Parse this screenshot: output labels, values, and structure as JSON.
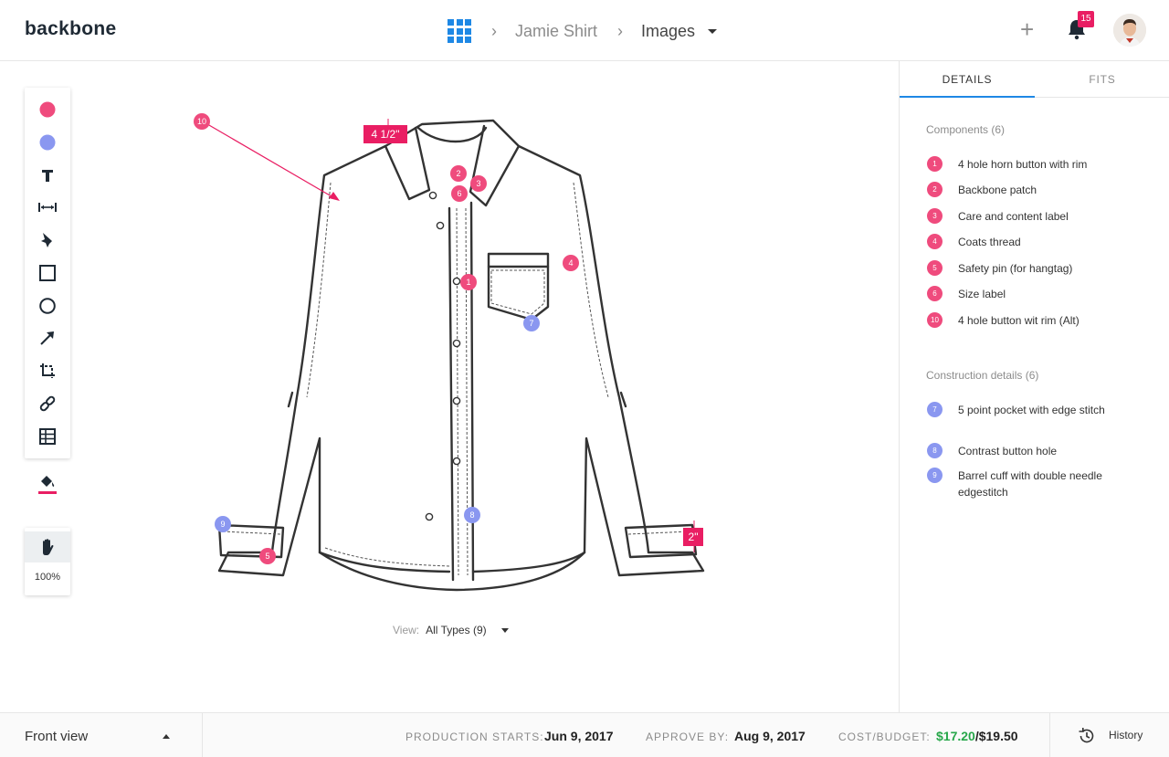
{
  "header": {
    "logo": "backbone",
    "breadcrumb": [
      "Jamie Shirt",
      "Images"
    ],
    "notification_count": "15"
  },
  "toolbar": {
    "tools": [
      "pink-dot-icon",
      "blue-dot-icon",
      "text-icon",
      "measure-icon",
      "pen-icon",
      "rectangle-icon",
      "circle-icon",
      "arrow-icon",
      "crop-icon",
      "link-icon",
      "table-icon"
    ],
    "fill_icon": "fill-bucket-icon",
    "hand_icon": "hand-icon",
    "zoom": "100%"
  },
  "canvas": {
    "measurements": {
      "collar": "4 1/2\"",
      "cuff": "2\""
    },
    "pins": [
      "10",
      "2",
      "3",
      "6",
      "4",
      "1",
      "7",
      "8",
      "9",
      "5"
    ],
    "view_label": "View:",
    "view_value": "All Types (9)"
  },
  "panel": {
    "tabs": [
      "DETAILS",
      "FITS"
    ],
    "components_title": "Components (6)",
    "components": [
      {
        "num": "1",
        "label": "4 hole horn button with rim"
      },
      {
        "num": "2",
        "label": "Backbone patch"
      },
      {
        "num": "3",
        "label": "Care and content label"
      },
      {
        "num": "4",
        "label": "Coats thread"
      },
      {
        "num": "5",
        "label": "Safety pin (for hangtag)"
      },
      {
        "num": "6",
        "label": "Size label"
      },
      {
        "num": "10",
        "label": "4 hole button wit rim (Alt)"
      }
    ],
    "construction_title": "Construction details (6)",
    "construction": [
      {
        "num": "7",
        "label": "5 point pocket with edge stitch"
      },
      {
        "num": "8",
        "label": "Contrast button hole"
      },
      {
        "num": "9",
        "label": "Barrel cuff with double needle edgestitch"
      }
    ]
  },
  "footer": {
    "view_select": "Front view",
    "production_label": "PRODUCTION STARTS:",
    "production_value": "Jun 9, 2017",
    "approve_label": "APPROVE BY:",
    "approve_value": "Aug 9, 2017",
    "cost_label": "COST/BUDGET:",
    "cost_value": "$17.20",
    "budget_value": "/$19.50",
    "history": "History"
  },
  "colors": {
    "accent_blue": "#1e88e5",
    "pin_pink": "#ef4b7d",
    "pin_blue": "#8a97f0",
    "measure_pink": "#e91e63",
    "cost_green": "#27a74a"
  }
}
